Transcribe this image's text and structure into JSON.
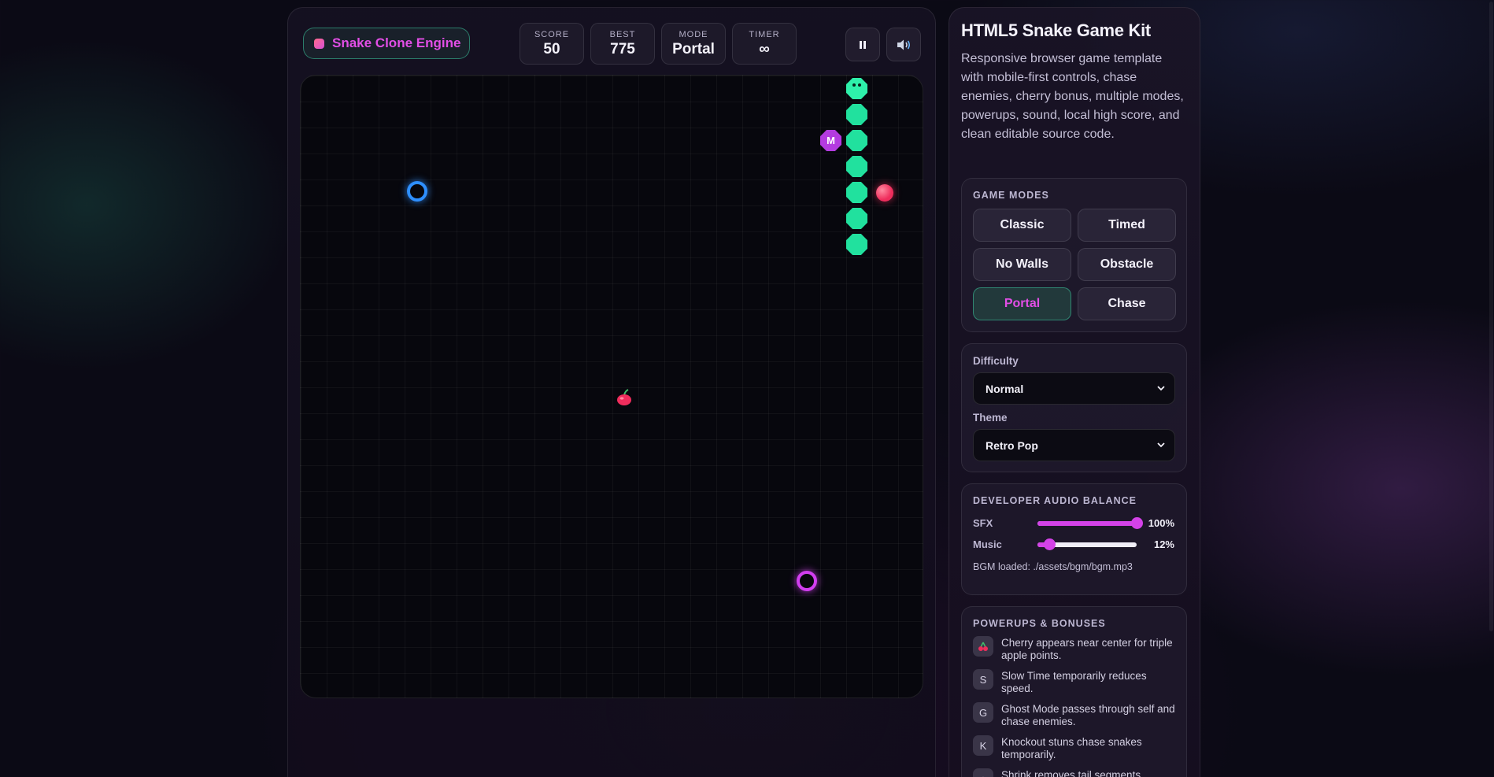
{
  "brand": {
    "name": "Snake Clone Engine",
    "accent": "#e24ee6"
  },
  "stats": [
    {
      "label": "SCORE",
      "value": "50"
    },
    {
      "label": "BEST",
      "value": "775"
    },
    {
      "label": "MODE",
      "value": "Portal"
    },
    {
      "label": "TIMER",
      "value": "∞"
    }
  ],
  "controls": {
    "pause_icon": "pause-icon",
    "sound_icon": "speaker-icon"
  },
  "board": {
    "grid": "24x24",
    "colors": {
      "snake": "#21e19e",
      "apple": "#ef2d5c",
      "portal_a": "#2e8fff",
      "portal_b": "#d23ef0",
      "powerup": "#b43be0"
    },
    "powerup_label": "M"
  },
  "side": {
    "title": "HTML5 Snake Game Kit",
    "description": "Responsive browser game template with mobile-first controls, chase enemies, cherry bonus, multiple modes, powerups, sound, local high score, and clean editable source code.",
    "modes_heading": "GAME MODES",
    "modes": [
      {
        "label": "Classic",
        "active": false
      },
      {
        "label": "Timed",
        "active": false
      },
      {
        "label": "No Walls",
        "active": false
      },
      {
        "label": "Obstacle",
        "active": false
      },
      {
        "label": "Portal",
        "active": true
      },
      {
        "label": "Chase",
        "active": false
      }
    ],
    "difficulty_label": "Difficulty",
    "difficulty_value": "Normal",
    "theme_label": "Theme",
    "theme_value": "Retro Pop",
    "audio_heading": "DEVELOPER AUDIO BALANCE",
    "sfx_label": "SFX",
    "sfx_value": "100%",
    "sfx_level": 1.0,
    "music_label": "Music",
    "music_value": "12%",
    "music_level": 0.12,
    "bgm_note": "BGM loaded: ./assets/bgm/bgm.mp3",
    "powerups_heading": "POWERUPS & BONUSES",
    "powerups": [
      {
        "icon": "🍒",
        "text": "Cherry appears near center for triple apple points."
      },
      {
        "icon": "S",
        "text": "Slow Time temporarily reduces speed."
      },
      {
        "icon": "G",
        "text": "Ghost Mode passes through self and chase enemies."
      },
      {
        "icon": "K",
        "text": "Knockout stuns chase snakes temporarily."
      },
      {
        "icon": "↓",
        "text": "Shrink removes tail segments."
      }
    ]
  }
}
